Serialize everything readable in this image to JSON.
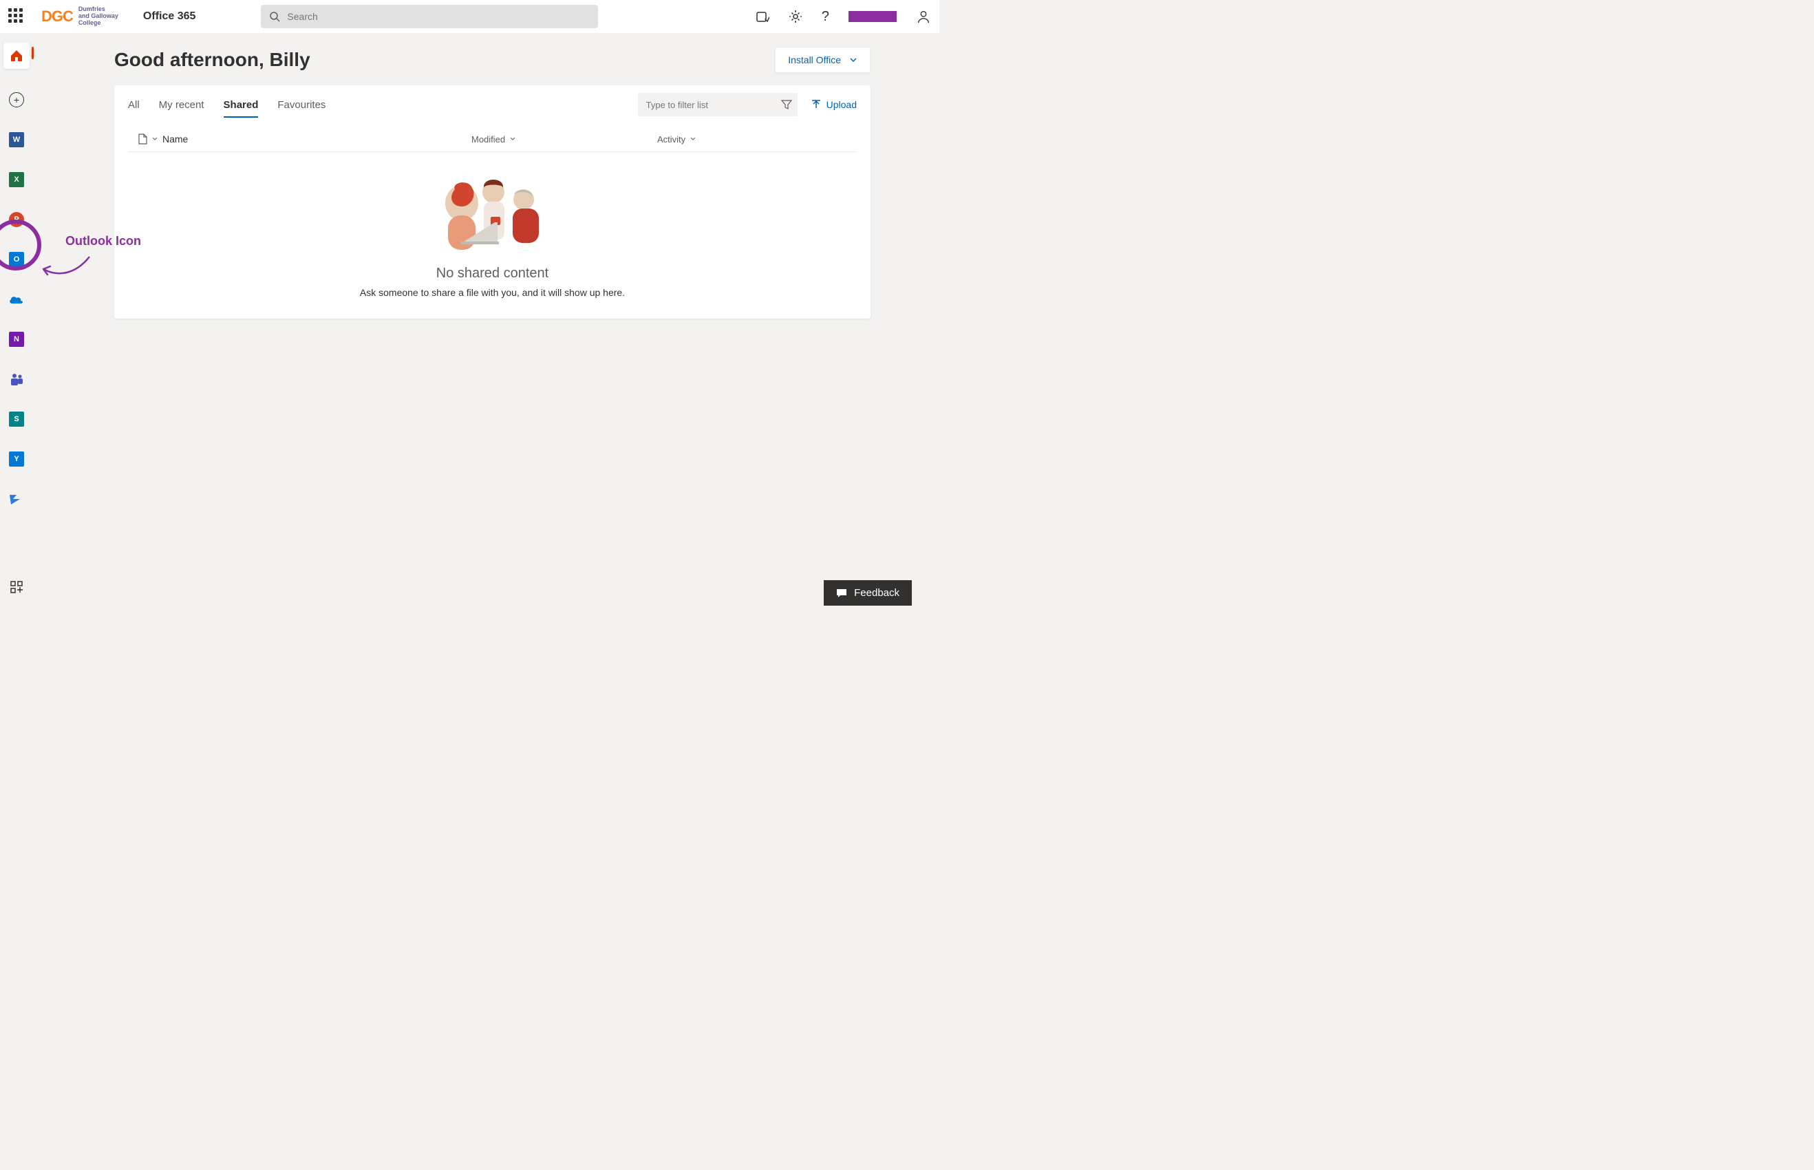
{
  "header": {
    "brand_abbrev": "DGC",
    "brand_line1": "Dumfries",
    "brand_line2": "and Galloway",
    "brand_line3": "College",
    "app_name": "Office 365",
    "search_placeholder": "Search"
  },
  "sidebar": {
    "apps": [
      {
        "name": "home",
        "color": "#d83b01",
        "letter": ""
      },
      {
        "name": "create",
        "color": "",
        "letter": "+"
      },
      {
        "name": "word",
        "color": "#2b579a",
        "letter": "W"
      },
      {
        "name": "excel",
        "color": "#217346",
        "letter": "X"
      },
      {
        "name": "powerpoint",
        "color": "#d24726",
        "letter": "P"
      },
      {
        "name": "outlook",
        "color": "#0078d4",
        "letter": "O"
      },
      {
        "name": "onedrive",
        "color": "#0078d4",
        "letter": ""
      },
      {
        "name": "onenote",
        "color": "#7719aa",
        "letter": "N"
      },
      {
        "name": "teams",
        "color": "#4b53bc",
        "letter": ""
      },
      {
        "name": "sharepoint",
        "color": "#038387",
        "letter": "S"
      },
      {
        "name": "yammer",
        "color": "#0078d4",
        "letter": "Y"
      },
      {
        "name": "power-automate",
        "color": "#0066ff",
        "letter": ""
      }
    ]
  },
  "main": {
    "greeting": "Good afternoon, Billy",
    "install_label": "Install Office",
    "tabs": [
      {
        "label": "All",
        "active": false
      },
      {
        "label": "My recent",
        "active": false
      },
      {
        "label": "Shared",
        "active": true
      },
      {
        "label": "Favourites",
        "active": false
      }
    ],
    "filter_placeholder": "Type to filter list",
    "upload_label": "Upload",
    "columns": {
      "name": "Name",
      "modified": "Modified",
      "activity": "Activity"
    },
    "empty": {
      "title": "No shared content",
      "subtitle": "Ask someone to share a file with you, and it will show up here."
    }
  },
  "annotation": {
    "label": "Outlook Icon"
  },
  "feedback": {
    "label": "Feedback"
  }
}
